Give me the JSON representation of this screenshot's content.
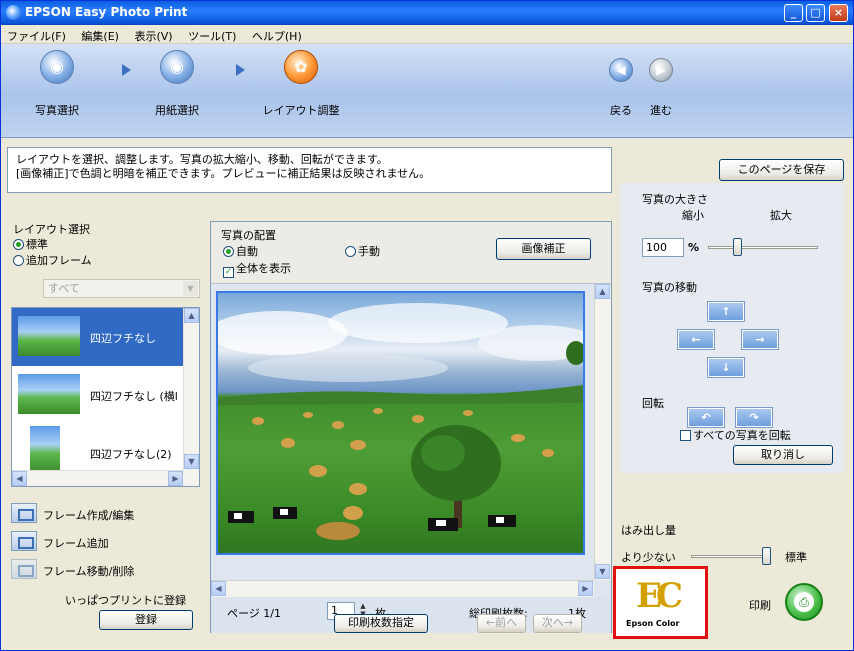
{
  "window": {
    "title": "EPSON Easy Photo Print"
  },
  "menu": [
    "ファイル(F)",
    "編集(E)",
    "表示(V)",
    "ツール(T)",
    "ヘルプ(H)"
  ],
  "steps": {
    "photo_select": "写真選択",
    "paper_select": "用紙選択",
    "layout_adjust": "レイアウト調整",
    "back": "戻る",
    "next": "進む"
  },
  "description": {
    "line1": "レイアウトを選択、調整します。写真の拡大縮小、移動、回転ができます。",
    "line2": "[画像補正]で色調と明暗を補正できます。プレビューに補正結果は反映されません。"
  },
  "save_page_button": "このページを保存",
  "layout_panel": {
    "title": "レイアウト選択",
    "option_standard": "標準",
    "option_add_frame": "追加フレーム",
    "filter_value": "すべて",
    "frames": [
      {
        "label": "四辺フチなし"
      },
      {
        "label": "四辺フチなし (横l"
      },
      {
        "label": "四辺フチなし(2)"
      }
    ],
    "actions": {
      "create_edit": "フレーム作成/編集",
      "add": "フレーム追加",
      "move_delete": "フレーム移動/削除"
    },
    "register_text": "いっぱつプリントに登録",
    "register_button": "登録"
  },
  "preview": {
    "placement_title": "写真の配置",
    "auto": "自動",
    "manual": "手動",
    "show_all": "全体を表示",
    "image_correct_button": "画像補正",
    "page_label": "ページ 1/1",
    "copies_value": "1",
    "copies_unit": "枚",
    "total_label": "総印刷枚数:",
    "total_value": "1枚",
    "count_setting_button": "印刷枚数指定",
    "prev_button": "←前へ",
    "next_button": "次へ→"
  },
  "photo_panel": {
    "size_title": "写真の大きさ",
    "shrink": "縮小",
    "enlarge": "拡大",
    "zoom_value": "100",
    "zoom_unit": "%",
    "zoom_level": 0.25,
    "move_title": "写真の移動",
    "rotate_title": "回転",
    "rotate_all": "すべての写真を回転",
    "undo_button": "取り消し"
  },
  "overflow": {
    "title": "はみ出し量",
    "less": "より少ない",
    "standard": "標準",
    "level": 1.0
  },
  "epson_color": {
    "mark": "EC",
    "wordmark": "Epson Color"
  },
  "print_label": "印刷",
  "colors": {
    "accent": "#316ac5",
    "titlebar": "#0a5ee0",
    "logo_highlight": "#e01010",
    "print_button": "#4cc04c"
  }
}
